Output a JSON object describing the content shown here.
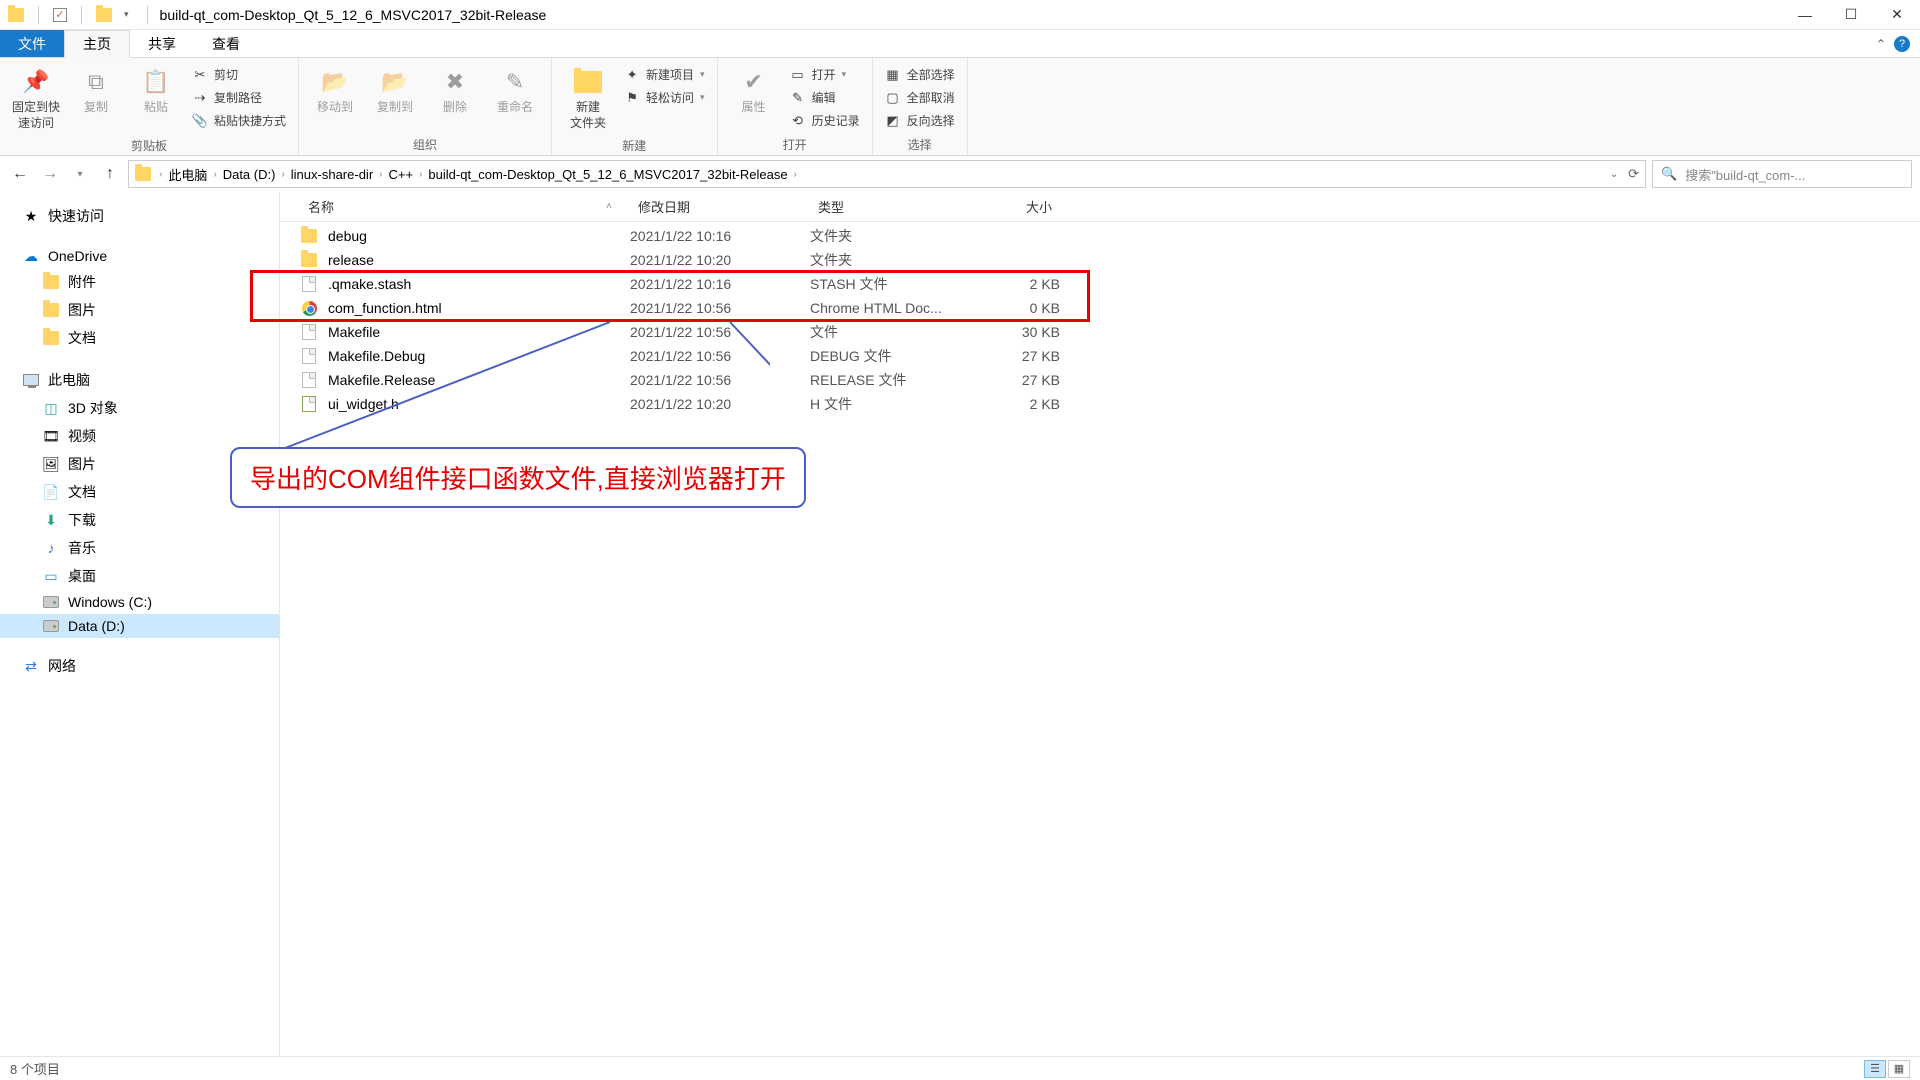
{
  "window": {
    "title": "build-qt_com-Desktop_Qt_5_12_6_MSVC2017_32bit-Release"
  },
  "tabs": {
    "file": "文件",
    "home": "主页",
    "share": "共享",
    "view": "查看"
  },
  "ribbon": {
    "clipboard": {
      "pin": "固定到快\n速访问",
      "copy": "复制",
      "paste": "粘贴",
      "cut": "剪切",
      "copypath": "复制路径",
      "pasteshortcut": "粘贴快捷方式",
      "label": "剪贴板"
    },
    "organize": {
      "moveto": "移动到",
      "copyto": "复制到",
      "delete": "删除",
      "rename": "重命名",
      "label": "组织"
    },
    "new": {
      "newfolder": "新建\n文件夹",
      "newitem": "新建项目",
      "easyaccess": "轻松访问",
      "label": "新建"
    },
    "open": {
      "properties": "属性",
      "open": "打开",
      "edit": "编辑",
      "history": "历史记录",
      "label": "打开"
    },
    "select": {
      "selectall": "全部选择",
      "selectnone": "全部取消",
      "invert": "反向选择",
      "label": "选择"
    }
  },
  "breadcrumbs": [
    "此电脑",
    "Data (D:)",
    "linux-share-dir",
    "C++",
    "build-qt_com-Desktop_Qt_5_12_6_MSVC2017_32bit-Release"
  ],
  "search": {
    "placeholder": "搜索\"build-qt_com-..."
  },
  "sidebar": {
    "quick": "快速访问",
    "onedrive": "OneDrive",
    "onedrive_children": [
      "附件",
      "图片",
      "文档"
    ],
    "thispc": "此电脑",
    "thispc_children": [
      "3D 对象",
      "视频",
      "图片",
      "文档",
      "下载",
      "音乐",
      "桌面",
      "Windows (C:)",
      "Data (D:)"
    ],
    "network": "网络"
  },
  "columns": {
    "name": "名称",
    "date": "修改日期",
    "type": "类型",
    "size": "大小"
  },
  "files": [
    {
      "icon": "folder",
      "name": "debug",
      "date": "2021/1/22 10:16",
      "type": "文件夹",
      "size": ""
    },
    {
      "icon": "folder",
      "name": "release",
      "date": "2021/1/22 10:20",
      "type": "文件夹",
      "size": ""
    },
    {
      "icon": "file",
      "name": ".qmake.stash",
      "date": "2021/1/22 10:16",
      "type": "STASH 文件",
      "size": "2 KB"
    },
    {
      "icon": "chrome",
      "name": "com_function.html",
      "date": "2021/1/22 10:56",
      "type": "Chrome HTML Doc...",
      "size": "0 KB"
    },
    {
      "icon": "file",
      "name": "Makefile",
      "date": "2021/1/22 10:56",
      "type": "文件",
      "size": "30 KB"
    },
    {
      "icon": "file",
      "name": "Makefile.Debug",
      "date": "2021/1/22 10:56",
      "type": "DEBUG 文件",
      "size": "27 KB"
    },
    {
      "icon": "file",
      "name": "Makefile.Release",
      "date": "2021/1/22 10:56",
      "type": "RELEASE 文件",
      "size": "27 KB"
    },
    {
      "icon": "header",
      "name": "ui_widget.h",
      "date": "2021/1/22 10:20",
      "type": "H 文件",
      "size": "2 KB"
    }
  ],
  "annotation": {
    "text": "导出的COM组件接口函数文件,直接浏览器打开"
  },
  "status": {
    "count": "8 个项目"
  }
}
